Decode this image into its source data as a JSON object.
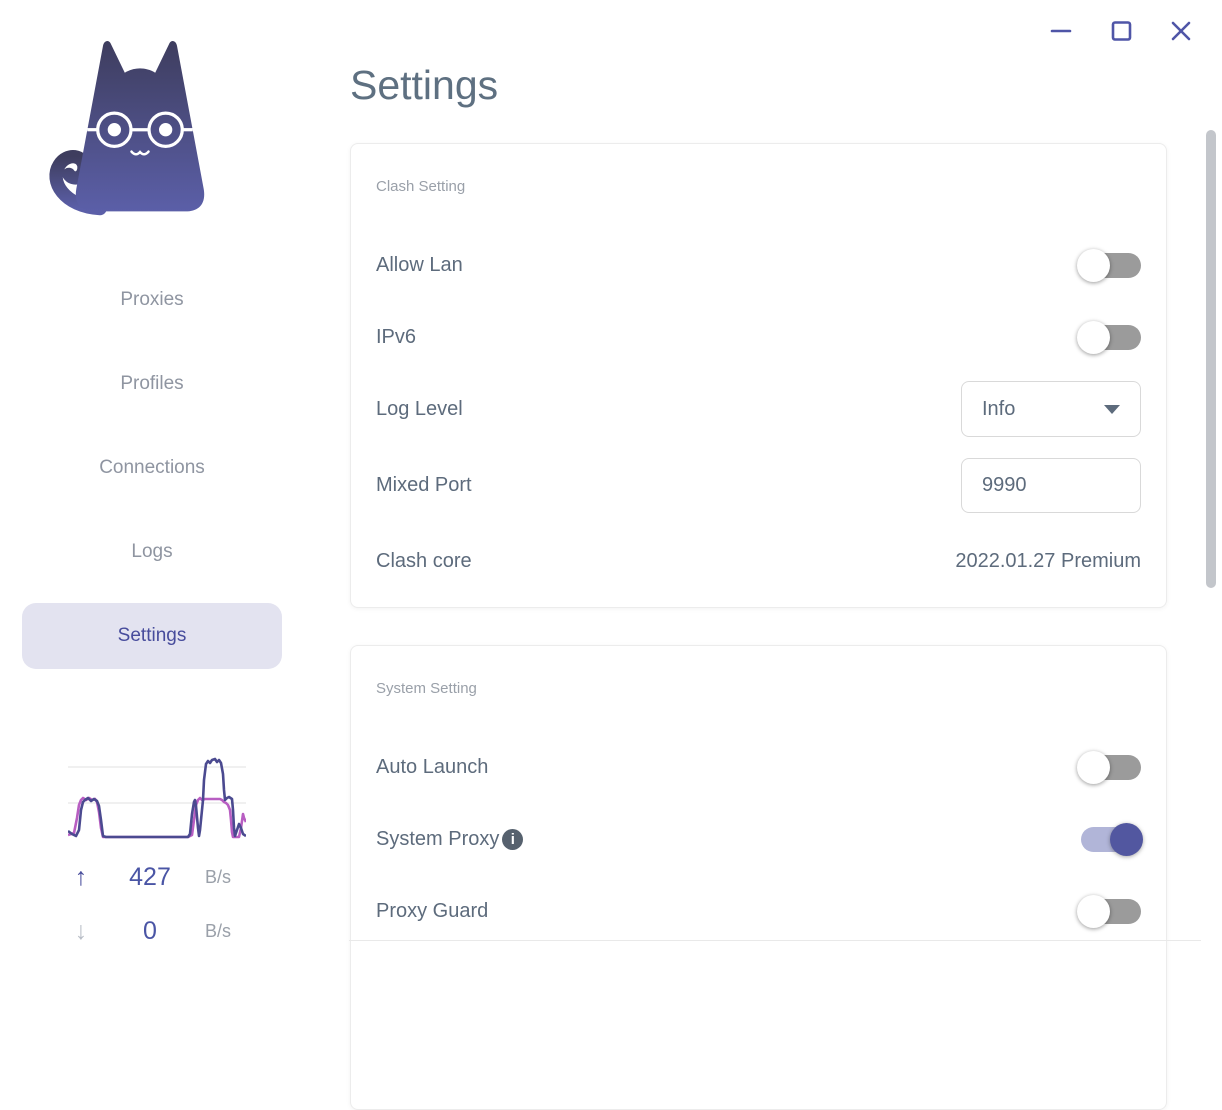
{
  "window": {
    "controls": [
      {
        "name": "minimize",
        "icon": "minimize-icon"
      },
      {
        "name": "maximize",
        "icon": "maximize-icon"
      },
      {
        "name": "close",
        "icon": "close-icon"
      }
    ]
  },
  "sidebar": {
    "logo": "clash-cat-logo",
    "nav": [
      {
        "label": "Proxies",
        "active": false
      },
      {
        "label": "Profiles",
        "active": false
      },
      {
        "label": "Connections",
        "active": false
      },
      {
        "label": "Logs",
        "active": false
      },
      {
        "label": "Settings",
        "active": true
      }
    ],
    "traffic": {
      "upload": {
        "icon_glyph": "↑",
        "value": "427",
        "unit": "B/s"
      },
      "download": {
        "icon_glyph": "↓",
        "value": "0",
        "unit": "B/s"
      }
    }
  },
  "main": {
    "title": "Settings",
    "cards": [
      {
        "caption": "Clash Setting",
        "rows": [
          {
            "label": "Allow Lan",
            "control": "toggle",
            "state": "off"
          },
          {
            "label": "IPv6",
            "control": "toggle",
            "state": "off"
          },
          {
            "label": "Log Level",
            "control": "select",
            "value": "Info"
          },
          {
            "label": "Mixed Port",
            "control": "input",
            "value": "9990"
          },
          {
            "label": "Clash core",
            "control": "text",
            "value": "2022.01.27 Premium"
          }
        ]
      },
      {
        "caption": "System Setting",
        "rows": [
          {
            "label": "Auto Launch",
            "control": "toggle",
            "state": "off"
          },
          {
            "label": "System Proxy",
            "control": "toggle",
            "state": "on",
            "info_icon": "info-icon"
          },
          {
            "label": "Proxy Guard",
            "control": "toggle",
            "state": "off"
          }
        ]
      }
    ]
  },
  "colors": {
    "accent": "#4f55a7",
    "nav_text": "#8f95a1",
    "nav_active_text": "#474c9c",
    "nav_active_bg": "#e3e3f0",
    "label_text": "#5d6b7c",
    "muted_text": "#9aa0a9",
    "title_text": "#5e7081",
    "toggle_off_track": "#9b9b9b",
    "toggle_on_track": "#b1b5d8",
    "toggle_on_knob": "#5257a0",
    "info_icon_bg": "#56616e",
    "graph_upload_line": "#4b4a90",
    "graph_download_line": "#b85ec2"
  }
}
